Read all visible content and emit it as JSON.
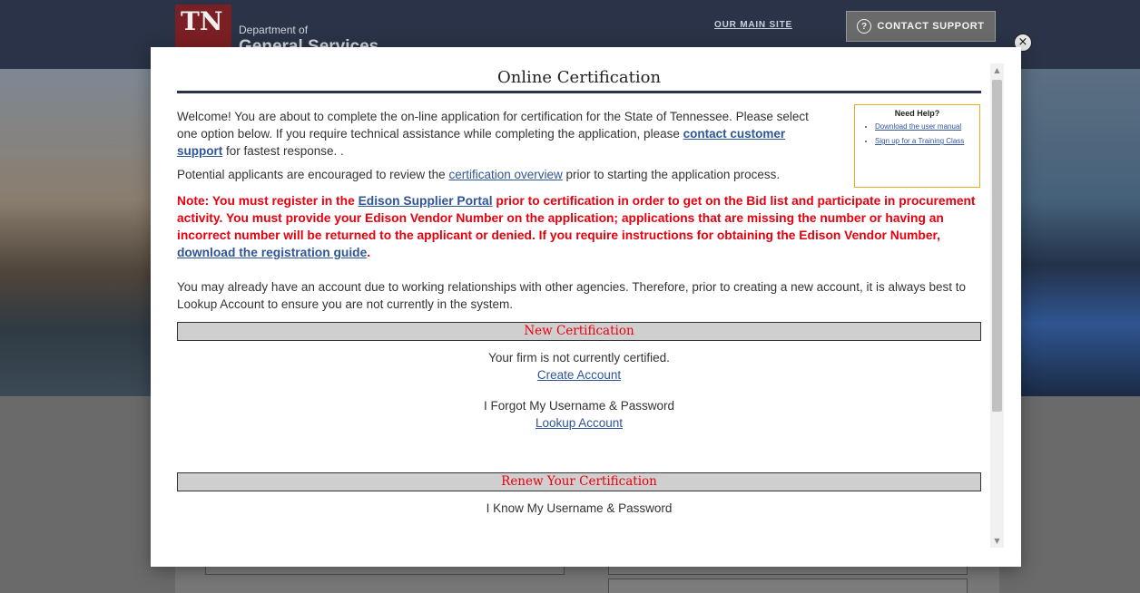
{
  "header": {
    "logo_letters": "TN",
    "dept_line1": "Department of",
    "dept_line2": "General Services",
    "main_site_link": "OUR MAIN SITE",
    "contact_support": "CONTACT SUPPORT",
    "contact_icon": "?"
  },
  "modal": {
    "close_icon": "×",
    "title": "Online Certification",
    "intro_welcome_1": "Welcome! You are about to complete the on-line application for certification for the State of Tennessee. Please select one option below. If you require technical assistance while completing the application, please ",
    "intro_contact_link": "contact customer support",
    "intro_welcome_2": " for fastest response. .",
    "overview_1": "Potential applicants are encouraged to review the ",
    "overview_link": "certification overview",
    "overview_2": " prior to starting the application process.",
    "help": {
      "title": "Need Help?",
      "items": [
        "Download the user manual",
        "Sign up for a Training Class"
      ]
    },
    "note_1": "Note: You must register in the ",
    "note_link_edison": "Edison Supplier Portal",
    "note_2": " prior to certification in order to get on the Bid list and participate in procurement activity. You must provide your Edison Vendor Number on the application; applications that are missing the number or having an incorrect number will be returned to the applicant or denied. If you require instructions for obtaining the Edison Vendor Number, ",
    "note_link_guide": "download the registration guide",
    "note_3": ".",
    "account_para": "You may already have an account due to working relationships with other agencies. Therefore, prior to creating a new account, it is always best to Lookup Account to ensure you are not currently in the system.",
    "new_cert": {
      "heading": "New Certification",
      "not_certified": "Your firm is not currently certified.",
      "create_account": "Create Account",
      "forgot": "I Forgot My Username & Password",
      "lookup_account": "Lookup Account"
    },
    "renew_cert": {
      "heading": "Renew Your Certification",
      "know": "I Know My Username & Password"
    }
  },
  "scrollbar": {
    "up_arrow": "▲",
    "down_arrow": "▼"
  }
}
